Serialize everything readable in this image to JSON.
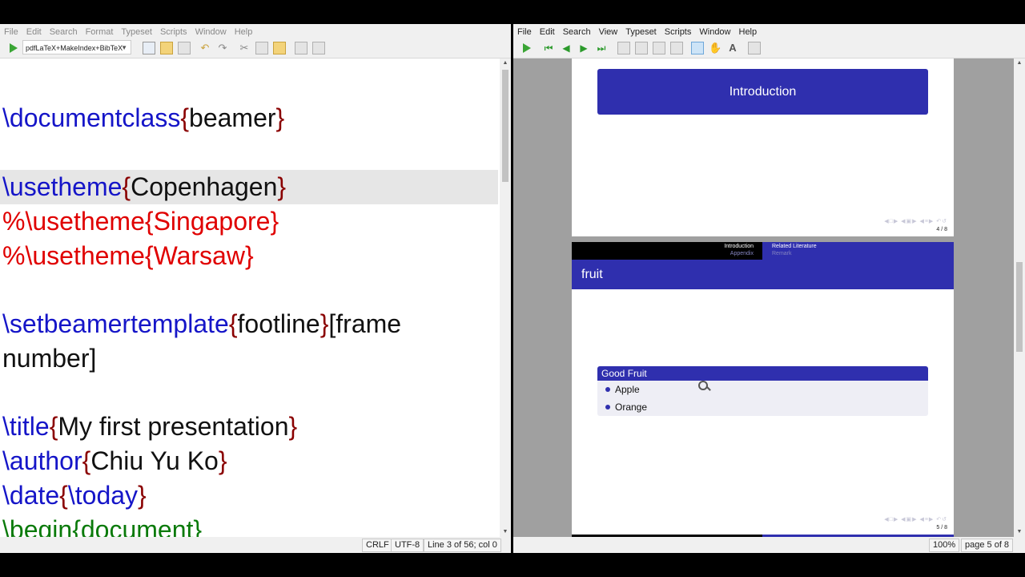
{
  "editor": {
    "menu": [
      "File",
      "Edit",
      "Search",
      "Format",
      "Typeset",
      "Scripts",
      "Window",
      "Help"
    ],
    "engine": "pdfLaTeX+MakeIndex+BibTeX",
    "lines": {
      "l1": {
        "cmd": "\\documentclass",
        "ob": "{",
        "arg": "beamer",
        "cb": "}"
      },
      "l2": {
        "cmd": "\\usetheme",
        "ob": "{",
        "arg": "Copenhagen",
        "cb": "}"
      },
      "l3": {
        "text": "%\\usetheme{Singapore}"
      },
      "l4": {
        "text": "%\\usetheme{Warsaw}"
      },
      "l5": {
        "cmd": "\\setbeamertemplate",
        "ob": "{",
        "arg": "footline",
        "cb": "}",
        "rest": "[frame"
      },
      "l6": {
        "text": "number]"
      },
      "l7": {
        "cmd": "\\title",
        "ob": "{",
        "arg": "My first presentation",
        "cb": "}"
      },
      "l8": {
        "cmd": "\\author",
        "ob": "{",
        "arg": "Chiu Yu Ko",
        "cb": "}"
      },
      "l9": {
        "cmd": "\\date",
        "ob": "{",
        "inner": "\\today",
        "cb": "}"
      },
      "l10": {
        "cmd": "\\begin",
        "ob": "{",
        "arg": "document",
        "cb": "}"
      }
    },
    "status": {
      "line_ending": "CRLF",
      "encoding": "UTF-8",
      "position": "Line 3 of 56; col 0"
    }
  },
  "viewer": {
    "menu": [
      "File",
      "Edit",
      "Search",
      "View",
      "Typeset",
      "Scripts",
      "Window",
      "Help"
    ],
    "slide4": {
      "title": "Introduction",
      "page": "4 / 8"
    },
    "slide5": {
      "sections": {
        "s1": "Introduction",
        "s1b": "Appendix",
        "s2": "Related Literature",
        "s2b": "Remark"
      },
      "frametitle": "fruit",
      "block_title": "Good Fruit",
      "items": [
        "Apple",
        "Orange"
      ],
      "page": "5 / 8"
    },
    "status": {
      "zoom": "100%",
      "page": "page 5 of 8"
    }
  },
  "colors": {
    "beamer_blue": "#2f2fae",
    "cmd_blue": "#1515c8",
    "comment_red": "#e00000",
    "env_green": "#0a7a0a"
  }
}
